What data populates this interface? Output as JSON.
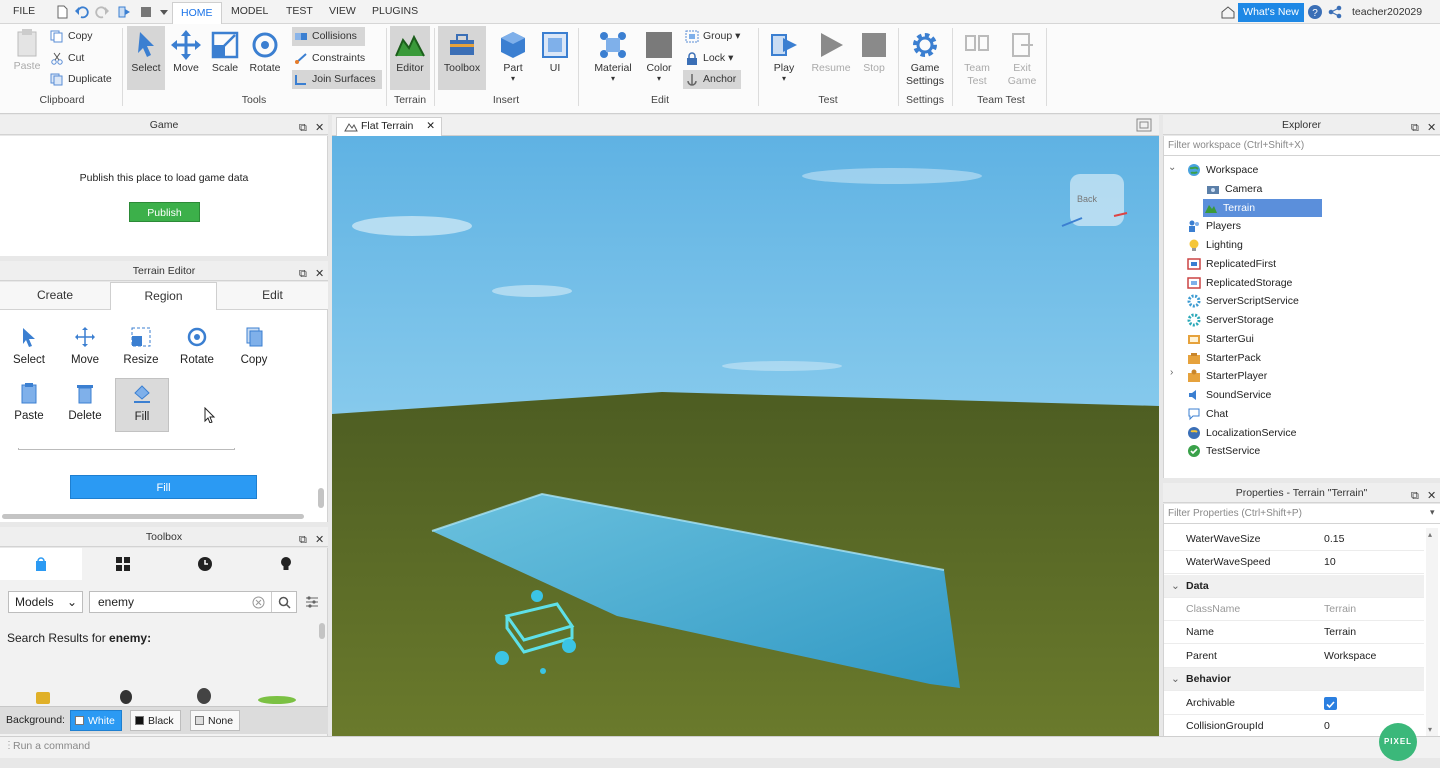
{
  "menubar": {
    "file": "FILE",
    "tabs": [
      "HOME",
      "MODEL",
      "TEST",
      "VIEW",
      "PLUGINS"
    ],
    "whats_new": "What's New",
    "username": "teacher202029"
  },
  "ribbon": {
    "clipboard": {
      "paste": "Paste",
      "copy": "Copy",
      "cut": "Cut",
      "duplicate": "Duplicate",
      "label": "Clipboard"
    },
    "tools": {
      "select": "Select",
      "move": "Move",
      "scale": "Scale",
      "rotate": "Rotate",
      "collisions": "Collisions",
      "constraints": "Constraints",
      "join_surfaces": "Join Surfaces",
      "label": "Tools"
    },
    "terrain": {
      "editor": "Editor",
      "label": "Terrain"
    },
    "insert": {
      "toolbox": "Toolbox",
      "part": "Part",
      "ui": "UI",
      "label": "Insert"
    },
    "edit": {
      "material": "Material",
      "color": "Color",
      "group": "Group",
      "lock": "Lock",
      "anchor": "Anchor",
      "label": "Edit"
    },
    "test": {
      "play": "Play",
      "resume": "Resume",
      "stop": "Stop",
      "label": "Test"
    },
    "settings": {
      "game_settings_1": "Game",
      "game_settings_2": "Settings",
      "label": "Settings"
    },
    "team_test": {
      "team_test_1": "Team",
      "team_test_2": "Test",
      "exit_game_1": "Exit",
      "exit_game_2": "Game",
      "label": "Team Test"
    }
  },
  "game_panel": {
    "title": "Game",
    "message": "Publish this place to load game data",
    "publish": "Publish"
  },
  "terrain_editor": {
    "title": "Terrain Editor",
    "tabs": [
      "Create",
      "Region",
      "Edit"
    ],
    "tools": [
      "Select",
      "Move",
      "Resize",
      "Rotate",
      "Copy",
      "Paste",
      "Delete",
      "Fill"
    ],
    "fill_button": "Fill"
  },
  "toolbox": {
    "title": "Toolbox",
    "category": "Models",
    "search_value": "enemy",
    "results_prefix": "Search Results for ",
    "results_query": "enemy:",
    "background_label": "Background:",
    "backgrounds": [
      "White",
      "Black",
      "None"
    ]
  },
  "viewport": {
    "tab": "Flat Terrain",
    "view_cube": "Back"
  },
  "explorer": {
    "title": "Explorer",
    "filter_placeholder": "Filter workspace (Ctrl+Shift+X)",
    "items": [
      "Workspace",
      "Camera",
      "Terrain",
      "Players",
      "Lighting",
      "ReplicatedFirst",
      "ReplicatedStorage",
      "ServerScriptService",
      "ServerStorage",
      "StarterGui",
      "StarterPack",
      "StarterPlayer",
      "SoundService",
      "Chat",
      "LocalizationService",
      "TestService"
    ]
  },
  "properties": {
    "title": "Properties - Terrain \"Terrain\"",
    "filter_placeholder": "Filter Properties (Ctrl+Shift+P)",
    "rows": [
      {
        "name": "WaterWaveSize",
        "value": "0.15"
      },
      {
        "name": "WaterWaveSpeed",
        "value": "10"
      },
      {
        "name": "Data",
        "value": ""
      },
      {
        "name": "ClassName",
        "value": "Terrain"
      },
      {
        "name": "Name",
        "value": "Terrain"
      },
      {
        "name": "Parent",
        "value": "Workspace"
      },
      {
        "name": "Behavior",
        "value": ""
      },
      {
        "name": "Archivable",
        "value": ""
      },
      {
        "name": "CollisionGroupId",
        "value": "0"
      }
    ]
  },
  "command_bar": {
    "placeholder": "Run a command"
  },
  "watermark": "PIXEL"
}
